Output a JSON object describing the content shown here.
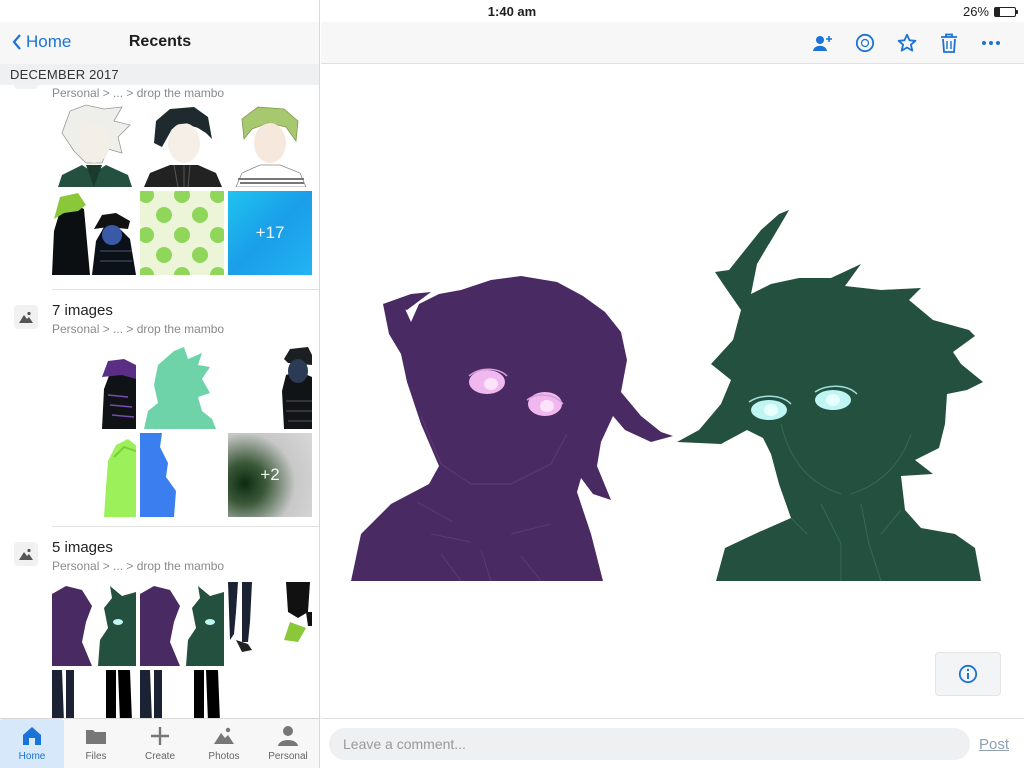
{
  "status_bar": {
    "device": "iPad",
    "time": "1:40 am",
    "battery": "26%",
    "battery_level": 0.26
  },
  "sidebar": {
    "back_label": "Home",
    "title": "Recents",
    "section_header": "DECEMBER 2017",
    "posts": [
      {
        "title": "",
        "path": "Personal > ... > drop the mambo",
        "more_label": "+17"
      },
      {
        "title": "7 images",
        "path": "Personal > ... > drop the mambo",
        "more_label": "+2"
      },
      {
        "title": "5 images",
        "path": "Personal > ... > drop the mambo"
      }
    ]
  },
  "tab_bar": {
    "tabs": [
      {
        "label": "Home",
        "icon": "home-icon",
        "active": true
      },
      {
        "label": "Files",
        "icon": "folder-icon"
      },
      {
        "label": "Create",
        "icon": "plus-icon"
      },
      {
        "label": "Photos",
        "icon": "photos-icon"
      },
      {
        "label": "Personal",
        "icon": "person-icon"
      }
    ]
  },
  "toolbar": {
    "actions": [
      "add-person-icon",
      "info-circle-icon",
      "star-icon",
      "trash-icon",
      "more-icon"
    ]
  },
  "comment": {
    "placeholder": "Leave a comment...",
    "post_label": "Post"
  },
  "colors": {
    "accent": "#1a73d6",
    "purple_character": "#4a2a63",
    "green_character": "#24503f",
    "purple_eyes": "#f0b8ee",
    "green_eyes": "#bff6f4"
  }
}
